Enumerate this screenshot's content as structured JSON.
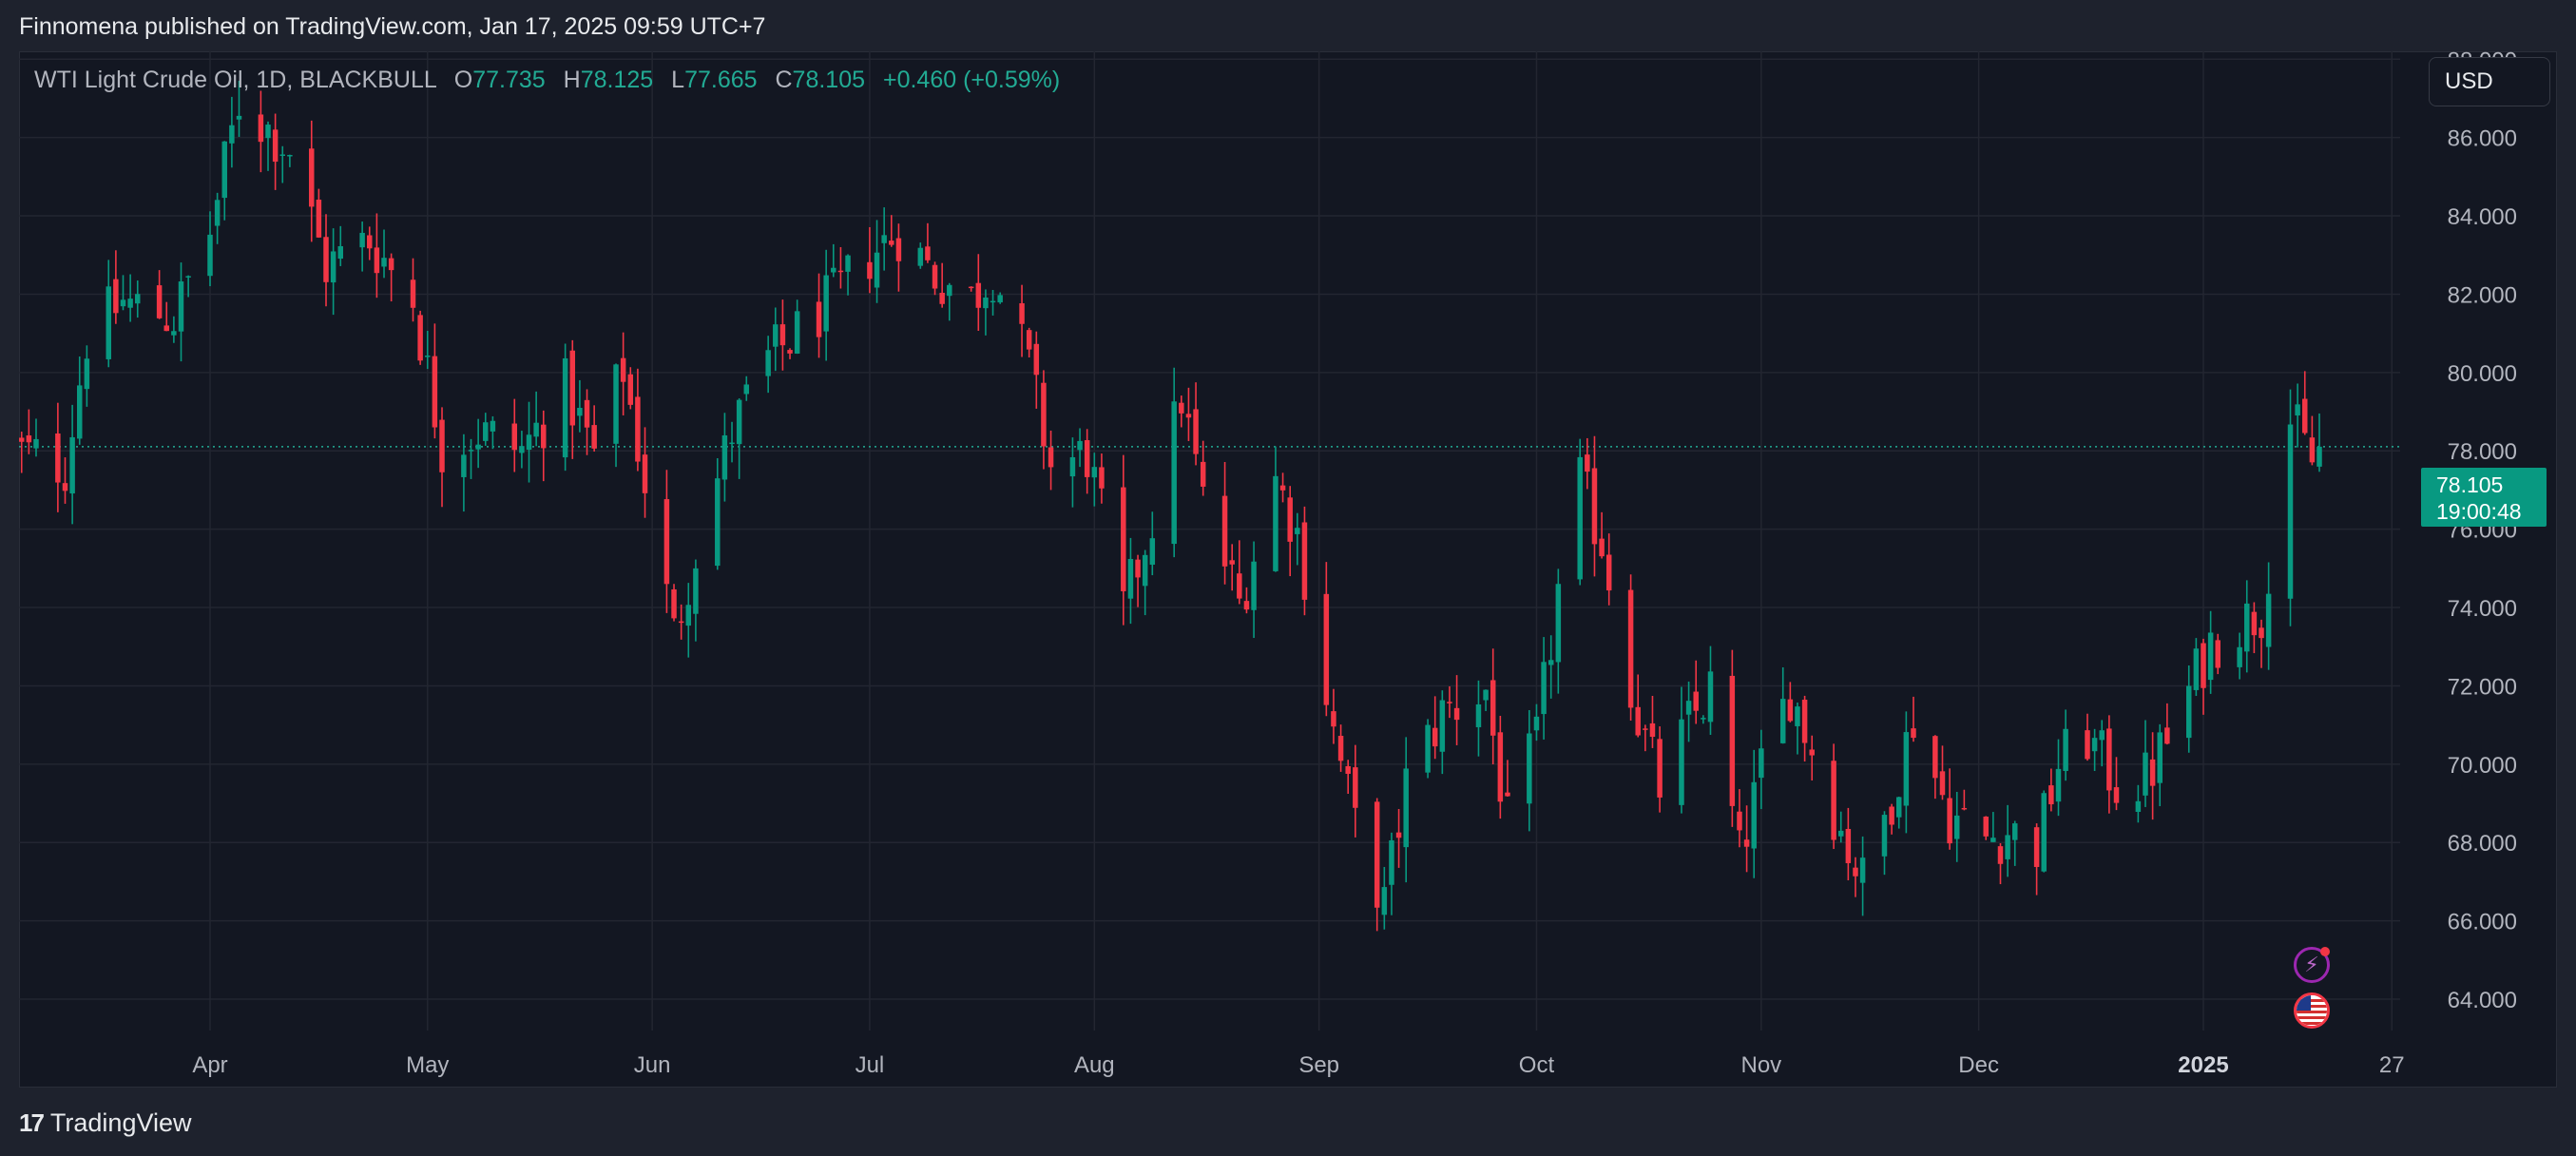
{
  "header": {
    "published_by": "Finnomena published on TradingView.com, Jan 17, 2025 09:59 UTC+7"
  },
  "legend": {
    "symbol": "WTI Light Crude Oil, 1D, BLACKBULL",
    "open_key": "O",
    "open": "77.735",
    "high_key": "H",
    "high": "78.125",
    "low_key": "L",
    "low": "77.665",
    "close_key": "C",
    "close": "78.105",
    "change": "+0.460 (+0.59%)"
  },
  "toolbar": {
    "currency": "USD"
  },
  "price_label": {
    "price": "78.105",
    "countdown": "19:00:48"
  },
  "footer": {
    "brand": "TradingView"
  },
  "icons": {
    "events": "lightning-icon",
    "country": "us-flag-icon",
    "logo": "tradingview-logo-icon"
  },
  "colors": {
    "up": "#089981",
    "down": "#f23645",
    "background": "#131722",
    "grid": "#232631",
    "axis_text": "#b2b5be"
  },
  "chart_data": {
    "type": "candlestick",
    "ylim": [
      63.2,
      88.2
    ],
    "y_ticks": [
      "64.000",
      "66.000",
      "68.000",
      "70.000",
      "72.000",
      "74.000",
      "76.000",
      "78.000",
      "80.000",
      "82.000",
      "84.000",
      "86.000",
      "88.000"
    ],
    "x_ticks": [
      {
        "label": "Apr",
        "date": "2024-04-01"
      },
      {
        "label": "May",
        "date": "2024-05-01"
      },
      {
        "label": "Jun",
        "date": "2024-06-01"
      },
      {
        "label": "Jul",
        "date": "2024-07-01"
      },
      {
        "label": "Aug",
        "date": "2024-08-01"
      },
      {
        "label": "Sep",
        "date": "2024-09-01"
      },
      {
        "label": "Oct",
        "date": "2024-10-01"
      },
      {
        "label": "Nov",
        "date": "2024-11-01"
      },
      {
        "label": "Dec",
        "date": "2024-12-01"
      },
      {
        "label": "2025",
        "date": "2025-01-01"
      },
      {
        "label": "27",
        "date": "2025-01-27"
      }
    ],
    "last_price": 78.105,
    "grid": true,
    "close_points": [
      [
        "2024-03-05",
        78.0
      ],
      [
        "2024-03-12",
        77.6
      ],
      [
        "2024-03-15",
        80.9
      ],
      [
        "2024-03-20",
        81.8
      ],
      [
        "2024-03-27",
        81.4
      ],
      [
        "2024-04-01",
        83.6
      ],
      [
        "2024-04-05",
        86.9
      ],
      [
        "2024-04-12",
        85.7
      ],
      [
        "2024-04-17",
        82.7
      ],
      [
        "2024-04-23",
        83.4
      ],
      [
        "2024-04-29",
        81.9
      ],
      [
        "2024-05-03",
        78.1
      ],
      [
        "2024-05-08",
        78.5
      ],
      [
        "2024-05-14",
        78.0
      ],
      [
        "2024-05-20",
        79.6
      ],
      [
        "2024-05-24",
        77.9
      ],
      [
        "2024-05-28",
        80.1
      ],
      [
        "2024-05-31",
        77.2
      ],
      [
        "2024-06-04",
        73.3
      ],
      [
        "2024-06-07",
        75.5
      ],
      [
        "2024-06-12",
        78.5
      ],
      [
        "2024-06-17",
        80.3
      ],
      [
        "2024-06-21",
        81.0
      ],
      [
        "2024-06-26",
        81.9
      ],
      [
        "2024-07-01",
        83.0
      ],
      [
        "2024-07-05",
        83.6
      ],
      [
        "2024-07-10",
        82.5
      ],
      [
        "2024-07-15",
        81.9
      ],
      [
        "2024-07-18",
        82.6
      ],
      [
        "2024-07-23",
        80.1
      ],
      [
        "2024-07-26",
        77.6
      ],
      [
        "2024-07-31",
        77.9
      ],
      [
        "2024-08-05",
        73.9
      ],
      [
        "2024-08-09",
        76.3
      ],
      [
        "2024-08-13",
        79.4
      ],
      [
        "2024-08-16",
        76.7
      ],
      [
        "2024-08-21",
        74.1
      ],
      [
        "2024-08-26",
        77.3
      ],
      [
        "2024-08-29",
        75.9
      ],
      [
        "2024-09-03",
        70.8
      ],
      [
        "2024-09-06",
        68.4
      ],
      [
        "2024-09-10",
        66.4
      ],
      [
        "2024-09-13",
        69.5
      ],
      [
        "2024-09-18",
        71.3
      ],
      [
        "2024-09-24",
        71.9
      ],
      [
        "2024-09-27",
        68.4
      ],
      [
        "2024-10-01",
        70.6
      ],
      [
        "2024-10-04",
        74.4
      ],
      [
        "2024-10-07",
        77.2
      ],
      [
        "2024-10-10",
        75.7
      ],
      [
        "2024-10-15",
        71.2
      ],
      [
        "2024-10-18",
        69.4
      ],
      [
        "2024-10-22",
        71.0
      ],
      [
        "2024-10-25",
        71.9
      ],
      [
        "2024-10-29",
        67.6
      ],
      [
        "2024-11-01",
        69.8
      ],
      [
        "2024-11-05",
        71.9
      ],
      [
        "2024-11-08",
        70.4
      ],
      [
        "2024-11-12",
        68.3
      ],
      [
        "2024-11-15",
        67.0
      ],
      [
        "2024-11-19",
        69.2
      ],
      [
        "2024-11-22",
        71.2
      ],
      [
        "2024-11-27",
        68.7
      ],
      [
        "2024-12-02",
        68.1
      ],
      [
        "2024-12-05",
        68.3
      ],
      [
        "2024-12-09",
        67.9
      ],
      [
        "2024-12-12",
        70.0
      ],
      [
        "2024-12-16",
        70.7
      ],
      [
        "2024-12-20",
        69.5
      ],
      [
        "2024-12-24",
        69.6
      ],
      [
        "2024-12-27",
        70.6
      ],
      [
        "2025-01-02",
        73.1
      ],
      [
        "2025-01-06",
        73.6
      ],
      [
        "2025-01-09",
        73.9
      ],
      [
        "2025-01-13",
        78.8
      ],
      [
        "2025-01-16",
        77.7
      ],
      [
        "2025-01-17",
        78.105
      ]
    ]
  }
}
